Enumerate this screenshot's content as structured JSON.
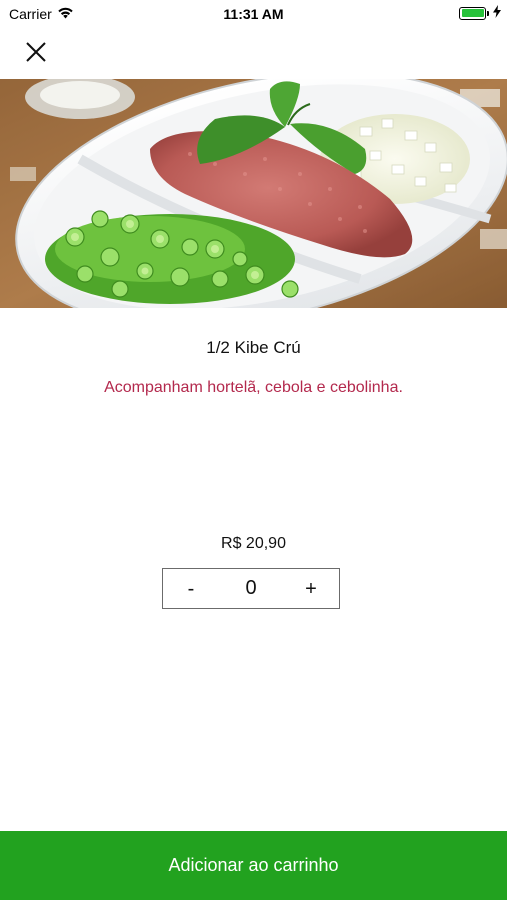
{
  "status_bar": {
    "carrier": "Carrier",
    "time": "11:31 AM",
    "battery_level": 1.0
  },
  "header": {
    "close_icon": "close-icon"
  },
  "product": {
    "image": "kibe-cru-dish-photo",
    "name": "1/2 Kibe Crú",
    "description": "Acompanham hortelã, cebola e cebolinha.",
    "price": "R$ 20,90",
    "quantity": "0",
    "decrement_label": "-",
    "increment_label": "+"
  },
  "footer": {
    "add_to_cart_label": "Adicionar ao carrinho"
  },
  "colors": {
    "accent_green": "#22a21f",
    "description_color": "#b3294d"
  }
}
